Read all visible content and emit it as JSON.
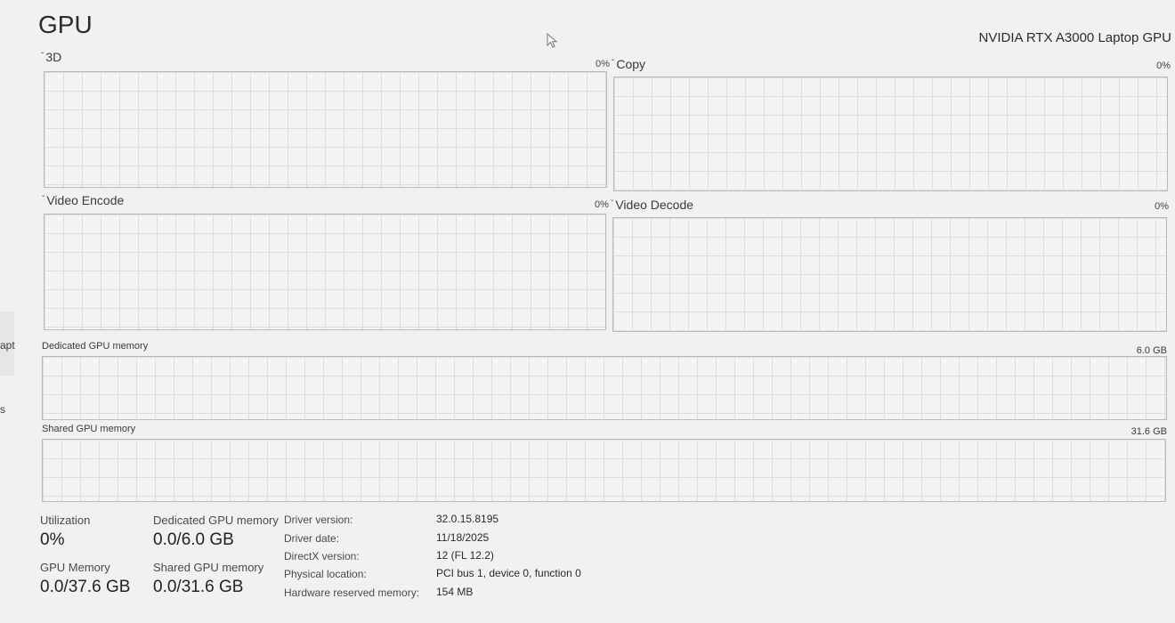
{
  "sidebar_fragments": {
    "item1": "apt",
    "item2": "s"
  },
  "header": {
    "title": "GPU",
    "gpu_name": "NVIDIA RTX A3000 Laptop GPU"
  },
  "engines": [
    {
      "label": "3D",
      "percent": "0%"
    },
    {
      "label": "Copy",
      "percent": "0%"
    },
    {
      "label": "Video Encode",
      "percent": "0%"
    },
    {
      "label": "Video Decode",
      "percent": "0%"
    }
  ],
  "memory_graphs": {
    "dedicated": {
      "label": "Dedicated GPU memory",
      "max": "6.0 GB"
    },
    "shared": {
      "label": "Shared GPU memory",
      "max": "31.6 GB"
    }
  },
  "stats": {
    "utilization": {
      "label": "Utilization",
      "value": "0%"
    },
    "dedicated_memory": {
      "label": "Dedicated GPU memory",
      "value": "0.0/6.0 GB"
    },
    "gpu_memory": {
      "label": "GPU Memory",
      "value": "0.0/37.6 GB"
    },
    "shared_memory": {
      "label": "Shared GPU memory",
      "value": "0.0/31.6 GB"
    }
  },
  "details": [
    {
      "label": "Driver version:",
      "value": "32.0.15.8195"
    },
    {
      "label": "Driver date:",
      "value": "11/18/2025"
    },
    {
      "label": "DirectX version:",
      "value": "12 (FL 12.2)"
    },
    {
      "label": "Physical location:",
      "value": "PCI bus 1, device 0, function 0"
    },
    {
      "label": "Hardware reserved memory:",
      "value": "154 MB"
    }
  ],
  "colors": {
    "background": "#f1f1f1",
    "graph_border": "#b9b9b9",
    "grid": "#dedede"
  }
}
